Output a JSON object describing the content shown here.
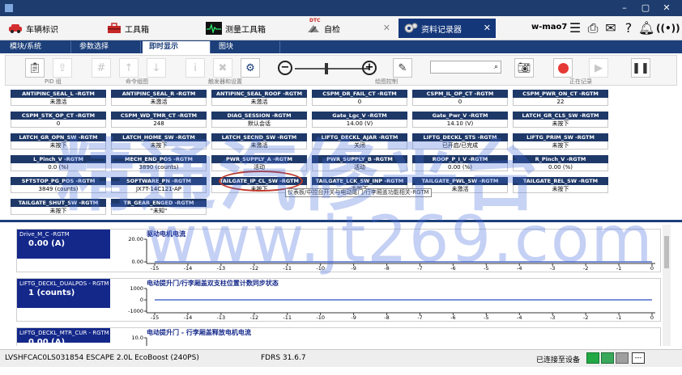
{
  "titlebar": {
    "minimize": "–",
    "maximize": "▢",
    "close": "✕"
  },
  "apptabs": [
    {
      "label": "车辆标识",
      "icon": "car-icon"
    },
    {
      "label": "工具箱",
      "icon": "toolbox-icon"
    },
    {
      "label": "测量工具箱",
      "icon": "oscilloscope-icon"
    },
    {
      "label": "自检",
      "icon": "dtc-icon",
      "badge": "DTC"
    },
    {
      "label": "资料记录器",
      "icon": "gears-icon"
    }
  ],
  "user": "w-mao7",
  "subtabs": [
    {
      "label": "模块/系统"
    },
    {
      "label": "参数选择"
    },
    {
      "label": "即时显示"
    },
    {
      "label": "图块"
    }
  ],
  "toolbar": {
    "pid_group_label": "PID 组",
    "order_label": "命令组图",
    "trigger_label": "触发器和设置",
    "graph_label": "绘图控制",
    "recording_label": "正在记录",
    "search_placeholder": ""
  },
  "pids": [
    {
      "name": "ANTIPINC_SEAL_L -RGTM",
      "value": "未激活"
    },
    {
      "name": "ANTIPINC_SEAL_R -RGTM",
      "value": "未激活"
    },
    {
      "name": "ANTIPINC_SEAL_ROOF -RGTM",
      "value": "未激活"
    },
    {
      "name": "CSPM_DR_FAIL_CT -RGTM",
      "value": "0"
    },
    {
      "name": "CSPM_IL_OP_CT -RGTM",
      "value": "0"
    },
    {
      "name": "CSPM_PWR_ON_CT -RGTM",
      "value": "22"
    },
    {
      "name": "CSPM_STK_OP_CT -RGTM",
      "value": "0"
    },
    {
      "name": "CSPM_WD_TMR_CT -RGTM",
      "value": "248"
    },
    {
      "name": "DIAG_SESSION -RGTM",
      "value": "默认会话"
    },
    {
      "name": "Gate_Lgc_V -RGTM",
      "value": "14.00 (V)"
    },
    {
      "name": "Gate_Pwr_V -RGTM",
      "value": "14.10 (V)"
    },
    {
      "name": "LATCH_GR_CLS_SW -RGTM",
      "value": "未按下"
    },
    {
      "name": "LATCH_GR_OPN_SW -RGTM",
      "value": "未按下"
    },
    {
      "name": "LATCH_HOME_SW -RGTM",
      "value": "未按下"
    },
    {
      "name": "LATCH_SECND_SW -RGTM",
      "value": "未激活"
    },
    {
      "name": "LIFTG_DECKL_AJAR -RGTM",
      "value": "关闭"
    },
    {
      "name": "LIFTG_DECKL_STS -RGTM",
      "value": "已开启/已完成"
    },
    {
      "name": "LIFTG_PRIM_SW -RGTM",
      "value": "未按下"
    },
    {
      "name": "L_Pinch_V -RGTM",
      "value": "0.0 (%)"
    },
    {
      "name": "MECH_END_POS -RGTM",
      "value": "3890 (counts)"
    },
    {
      "name": "PWR_SUPPLY_A -RGTM",
      "value": "活动"
    },
    {
      "name": "PWR_SUPPLY_B -RGTM",
      "value": "活动"
    },
    {
      "name": "ROOF_P_I_V -RGTM",
      "value": "0.00 (%)"
    },
    {
      "name": "R_Pinch_V -RGTM",
      "value": "0.00 (%)"
    },
    {
      "name": "SFTSTOP_PG_POS -RGTM",
      "value": "3849 (counts)"
    },
    {
      "name": "SOFTWARE_PN -RGTM",
      "value": "JX7T-14C121-AP"
    },
    {
      "name": "TAILGATE_IP_CL_SW -RGTM",
      "value": "未按下"
    },
    {
      "name": "TAILGATE_LCK_SW_INP -RGTM",
      "value": "未按下"
    },
    {
      "name": "TAILGATE_PWL_SW -RGTM",
      "value": "未激活"
    },
    {
      "name": "TAILGATE_REL_SW -RGTM",
      "value": "未按下"
    },
    {
      "name": "TAILGATE_SHUT_SW -RGTM",
      "value": "未按下"
    },
    {
      "name": "TR_GEAR_ENGED -RGTM",
      "value": "\"未知\""
    }
  ],
  "tooltip": "仪表板/中控台开关与电动尾门/行李厢盖功能相关-RGTM",
  "chart_data": [
    {
      "type": "line",
      "name": "Drive_M_C -RGTM",
      "value": "0.00 (A)",
      "title": "驱动电机电流",
      "y_ticks": [
        "20.00",
        "0.00"
      ],
      "ylim": [
        0,
        20
      ],
      "x": [
        -15,
        -14,
        -13,
        -12,
        -11,
        -10,
        -9,
        -8,
        -7,
        -6,
        -5,
        -4,
        -3,
        -2,
        -1,
        0
      ],
      "y": [
        0,
        0,
        0,
        0,
        0,
        0,
        0,
        0,
        0,
        0,
        0,
        0,
        0,
        0,
        0,
        0
      ]
    },
    {
      "type": "line",
      "name": "LIFTG_DECKL_DUALPOS - RGTM",
      "value": "1 (counts)",
      "title": "电动提升门/行李厢盖双支柱位置计数同步状态",
      "y_ticks": [
        "1000",
        "0",
        "-1000"
      ],
      "ylim": [
        -1000,
        1000
      ],
      "x": [
        -15,
        -14,
        -13,
        -12,
        -11,
        -10,
        -9,
        -8,
        -7,
        -6,
        -5,
        -4,
        -3,
        -2,
        -1,
        0
      ],
      "y": [
        1,
        1,
        1,
        1,
        1,
        1,
        1,
        1,
        1,
        1,
        1,
        1,
        1,
        1,
        1,
        1
      ]
    },
    {
      "type": "line",
      "name": "LIFTG_DECKL_MTR_CUR - RGTM",
      "value": "0.00 (A)",
      "title": "电动提升门 - 行李厢盖释放电机电流",
      "y_ticks": [
        "10.0"
      ],
      "ylim": [
        0,
        10
      ],
      "x": [],
      "y": []
    }
  ],
  "statusbar": {
    "vehicle": "LVSHFCAC0LS031854 ESCAPE 2.0L EcoBoost (240PS)",
    "version": "FDRS 31.6.7",
    "connection": "已连接至设备"
  },
  "watermark": {
    "cn": "精通汽修平台",
    "url": "www.jt269.com"
  }
}
